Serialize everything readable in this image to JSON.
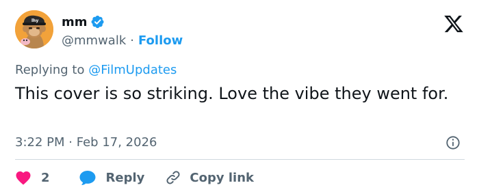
{
  "author": {
    "display_name": "mm",
    "handle": "@mmwalk",
    "separator": "·",
    "follow_label": "Follow",
    "verified": true
  },
  "reply_context": {
    "prefix": "Replying to",
    "mention": "@FilmUpdates"
  },
  "tweet": {
    "text": "This cover is so striking. Love the vibe they went for.",
    "time": "3:22 PM",
    "separator": "·",
    "date": "Feb 17, 2026"
  },
  "actions": {
    "likes": "2",
    "reply_label": "Reply",
    "copy_label": "Copy link"
  },
  "icons": {
    "brand": "x-logo-icon",
    "verified": "verified-badge-icon",
    "info": "info-icon",
    "like": "heart-icon",
    "reply": "speech-bubble-icon",
    "copy": "link-icon"
  },
  "colors": {
    "accent": "#1d9bf0",
    "text": "#0f1419",
    "muted": "#536471",
    "like": "#f91880",
    "divider": "#cfd9de"
  }
}
